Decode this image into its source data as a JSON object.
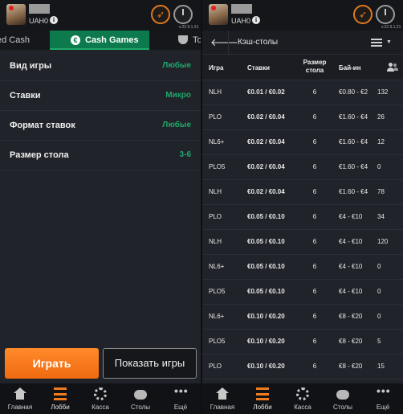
{
  "left": {
    "header": {
      "balance": "UAH0",
      "info": "i",
      "version": "v.22.9.1.21"
    },
    "tabs": {
      "sng": "ed Cash",
      "cash_games": "Cash Games",
      "tournaments": "To"
    },
    "filters": [
      {
        "label": "Вид игры",
        "value": "Любые"
      },
      {
        "label": "Ставки",
        "value": "Микро"
      },
      {
        "label": "Формат ставок",
        "value": "Любые"
      },
      {
        "label": "Размер стола",
        "value": "3-6"
      }
    ],
    "buttons": {
      "play": "Играть",
      "show_games": "Показать игры"
    },
    "bottom_nav": [
      {
        "label": "Главная",
        "icon": "home-icon"
      },
      {
        "label": "Лобби",
        "icon": "lobby-icon"
      },
      {
        "label": "Касса",
        "icon": "cashier-icon"
      },
      {
        "label": "Столы",
        "icon": "tables-icon"
      },
      {
        "label": "Ещё",
        "icon": "more-icon"
      }
    ]
  },
  "right": {
    "header": {
      "balance": "UAH0",
      "info": "i",
      "version": "v.22.9.1.21"
    },
    "title": "Кэш-столы",
    "back_glyph": "🡐",
    "table": {
      "headers": {
        "game": "Игра",
        "stakes": "Ставки",
        "size": "Размер стола",
        "buyin": "Бай-ин"
      },
      "rows": [
        {
          "game": "NLH",
          "stakes": "€0.01 / €0.02",
          "size": "6",
          "buyin": "€0.80 - €2",
          "players": "132"
        },
        {
          "game": "PLO",
          "stakes": "€0.02 / €0.04",
          "size": "6",
          "buyin": "€1.60 - €4",
          "players": "26"
        },
        {
          "game": "NL6+",
          "stakes": "€0.02 / €0.04",
          "size": "6",
          "buyin": "€1.60 - €4",
          "players": "12"
        },
        {
          "game": "PLO5",
          "stakes": "€0.02 / €0.04",
          "size": "6",
          "buyin": "€1.60 - €4",
          "players": "0"
        },
        {
          "game": "NLH",
          "stakes": "€0.02 / €0.04",
          "size": "6",
          "buyin": "€1.60 - €4",
          "players": "78"
        },
        {
          "game": "PLO",
          "stakes": "€0.05 / €0.10",
          "size": "6",
          "buyin": "€4 - €10",
          "players": "34"
        },
        {
          "game": "NLH",
          "stakes": "€0.05 / €0.10",
          "size": "6",
          "buyin": "€4 - €10",
          "players": "120"
        },
        {
          "game": "NL6+",
          "stakes": "€0.05 / €0.10",
          "size": "6",
          "buyin": "€4 - €10",
          "players": "0"
        },
        {
          "game": "PLO5",
          "stakes": "€0.05 / €0.10",
          "size": "6",
          "buyin": "€4 - €10",
          "players": "0"
        },
        {
          "game": "NL6+",
          "stakes": "€0.10 / €0.20",
          "size": "6",
          "buyin": "€8 - €20",
          "players": "0"
        },
        {
          "game": "PLO5",
          "stakes": "€0.10 / €0.20",
          "size": "6",
          "buyin": "€8 - €20",
          "players": "5"
        },
        {
          "game": "PLO",
          "stakes": "€0.10 / €0.20",
          "size": "6",
          "buyin": "€8 - €20",
          "players": "15"
        }
      ]
    },
    "bottom_nav": [
      {
        "label": "Главная",
        "icon": "home-icon"
      },
      {
        "label": "Лобби",
        "icon": "lobby-icon"
      },
      {
        "label": "Касса",
        "icon": "cashier-icon"
      },
      {
        "label": "Столы",
        "icon": "tables-icon"
      },
      {
        "label": "Ещё",
        "icon": "more-icon"
      }
    ]
  },
  "colors": {
    "accent_green": "#1ea96b",
    "tab_green": "#0c7a4c",
    "play_orange": "#f06a10",
    "background": "#202329"
  }
}
